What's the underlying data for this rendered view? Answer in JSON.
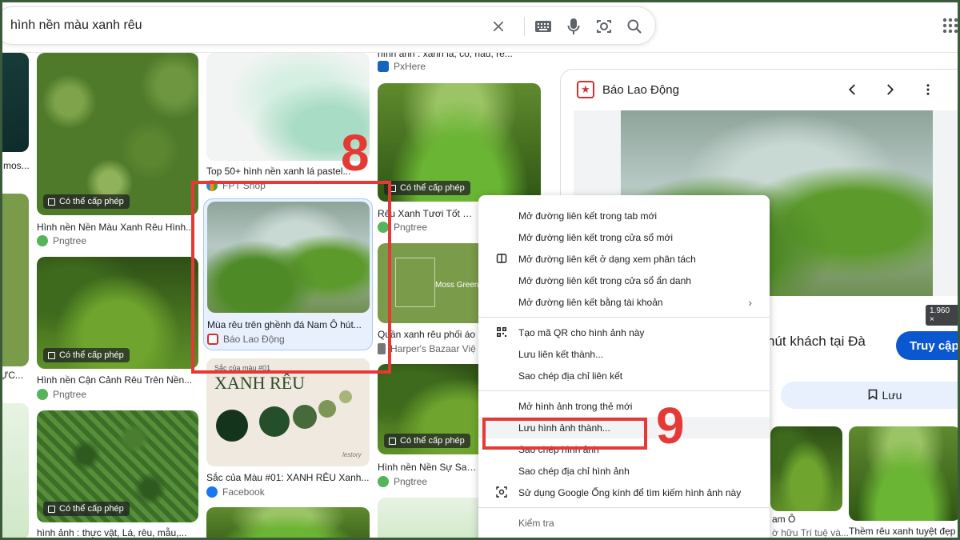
{
  "search": {
    "query": "hình nền màu xanh rêu"
  },
  "grid": {
    "col1": [
      {
        "badge": "Có thể cấp phép",
        "title": "Hình nền Nền Màu Xanh Rêu Hình...",
        "source": "Pngtree"
      },
      {
        "badge": "Có thể cấp phép",
        "title": "Hình nền Cận Cảnh Rêu Trên Nền...",
        "source": "Pngtree"
      },
      {
        "badge": "Có thể cấp phép",
        "title": "hình ảnh : thực vật, Lá, rêu, mẫu,...",
        "source": ""
      }
    ],
    "col0_fragments": [
      "mos...",
      "ỰC..."
    ],
    "col2": [
      {
        "title": "Top 50+ hình nền xanh lá pastel...",
        "source": "FPT Shop"
      },
      {
        "title": "Mùa rêu trên ghềnh đá Nam Ô hút...",
        "source": "Báo Lao Động"
      },
      {
        "card_label": "Sắc của màu #01",
        "card_heading": "XANH RÊU",
        "card_mark": "lestory",
        "title": "Sắc của Màu #01: XANH RÊU Xanh...",
        "source": "Facebook"
      }
    ],
    "col3": [
      {
        "title_top": "hình ảnh : xanh lá, cỏ, nâu, rê...",
        "source_top": "PxHere"
      },
      {
        "badge": "Có thể cấp phép",
        "title": "Rêu Xanh Tươi Tốt Bao",
        "source": "Pngtree"
      },
      {
        "card_text": "Moss Green",
        "title": "Quần xanh rêu phối áo",
        "source": "Harper's Bazaar Việ"
      },
      {
        "badge": "Có thể cấp phép",
        "title": "Hình nền Nền Sự Sang",
        "source": "Pngtree"
      }
    ]
  },
  "annotations": {
    "step_a": "8",
    "step_b": "9"
  },
  "panel": {
    "source": "Báo Lao Động",
    "logo_glyph": "★",
    "dimensions": "1.960 ×",
    "title": "hút khách tại Đà",
    "visit_label": "Truy cập",
    "save_label": "Lưu",
    "related": [
      {
        "title": "am Ô",
        "subtitle": "ờ hữu Trí tuệ và..."
      },
      {
        "title": "Thềm rêu xanh tuyệt đẹp",
        "subtitle": ""
      }
    ]
  },
  "context_menu": {
    "groups": [
      [
        {
          "label": "Mở đường liên kết trong tab mới",
          "icon": ""
        },
        {
          "label": "Mở đường liên kết trong cửa sổ mới",
          "icon": ""
        },
        {
          "label": "Mở đường liên kết ở dạng xem phân tách",
          "icon": "split-view-icon"
        },
        {
          "label": "Mở đường liên kết trong cửa sổ ẩn danh",
          "icon": ""
        },
        {
          "label": "Mở đường liên kết bằng tài khoản",
          "icon": "",
          "submenu": true
        }
      ],
      [
        {
          "label": "Tạo mã QR cho hình ảnh này",
          "icon": "qr-code-icon"
        },
        {
          "label": "Lưu liên kết thành...",
          "icon": ""
        },
        {
          "label": "Sao chép địa chỉ liên kết",
          "icon": ""
        }
      ],
      [
        {
          "label": "Mở hình ảnh trong thẻ mới",
          "icon": ""
        },
        {
          "label": "Lưu hình ảnh thành...",
          "icon": "",
          "highlight": true
        },
        {
          "label": "Sao chép hình ảnh",
          "icon": ""
        },
        {
          "label": "Sao chép địa chỉ hình ảnh",
          "icon": ""
        },
        {
          "label": "Sử dụng Google Ống kính để tìm kiếm hình ảnh này",
          "icon": "google-lens-icon"
        }
      ],
      [
        {
          "label": "Kiểm tra",
          "icon": ""
        }
      ]
    ]
  },
  "colors": {
    "accent_blue": "#0b57d0",
    "annotation_red": "#e53935",
    "frame": "#3a5a3a"
  }
}
